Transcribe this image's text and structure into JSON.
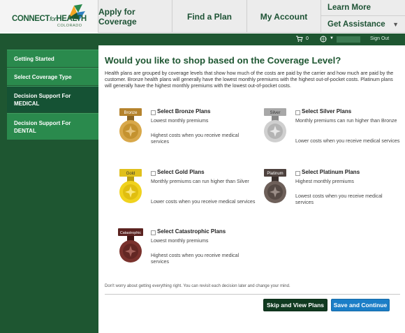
{
  "header": {
    "logo": {
      "name": "CONNECT for HEALTH",
      "main_left": "CONNECT",
      "for": "for",
      "main_right": "HEALTH",
      "sub": "COLORADO"
    },
    "nav": {
      "apply": "Apply for Coverage",
      "find_plan": "Find a Plan",
      "account": "My Account",
      "learn_more": "Learn More",
      "get_assistance": "Get Assistance"
    }
  },
  "status_bar": {
    "cart_count": "0",
    "sign_out": "Sign Out"
  },
  "sidebar": {
    "items": [
      {
        "label": "Getting Started"
      },
      {
        "label": "Select Coverage Type"
      },
      {
        "label": "Decision Support For MEDICAL"
      },
      {
        "label": "Decision Support For DENTAL"
      }
    ]
  },
  "main": {
    "title": "Would you like to shop based on the Coverage Level?",
    "intro": "Health plans are grouped by coverage levels that show how much of the costs are paid by the carrier and how much are paid by the customer. Bronze health plans will generally have the lowest monthly premiums with the highest out-of-pocket costs. Platinum plans will generally have the highest monthly premiums with the lowest out-of-pocket costs.",
    "plans": {
      "bronze": {
        "badge": "Bronze",
        "label": "Select Bronze Plans",
        "desc1": "Lowest monthly premiums",
        "desc2": "Highest costs when you receive medical services",
        "color": "#c89a3a"
      },
      "silver": {
        "badge": "Silver",
        "label": "Select Silver Plans",
        "desc1": "Monthly premiums can run higher than Bronze",
        "desc2": "Lower costs when you receive medical services",
        "color": "#b9b9b9"
      },
      "gold": {
        "badge": "Gold",
        "label": "Select Gold Plans",
        "desc1": "Monthly premiums can run higher than Silver",
        "desc2": "Lower costs when you receive medical services",
        "color": "#e7c620"
      },
      "platinum": {
        "badge": "Platinum",
        "label": "Select Platinum Plans",
        "desc1": "Highest monthly premiums",
        "desc2": "Lowest costs when you receive medical services",
        "color": "#5a4b47"
      },
      "catastrophic": {
        "badge": "Catastrophic",
        "label": "Select Catastrophic Plans",
        "desc1": "Lowest monthly premiums",
        "desc2": "Highest costs when you receive medical services",
        "color": "#6a2a26"
      }
    },
    "footnote": "Don't worry about getting everything right. You can revisit each decision later and change your mind.",
    "buttons": {
      "skip": "Skip and View Plans",
      "save": "Save and Continue"
    }
  }
}
